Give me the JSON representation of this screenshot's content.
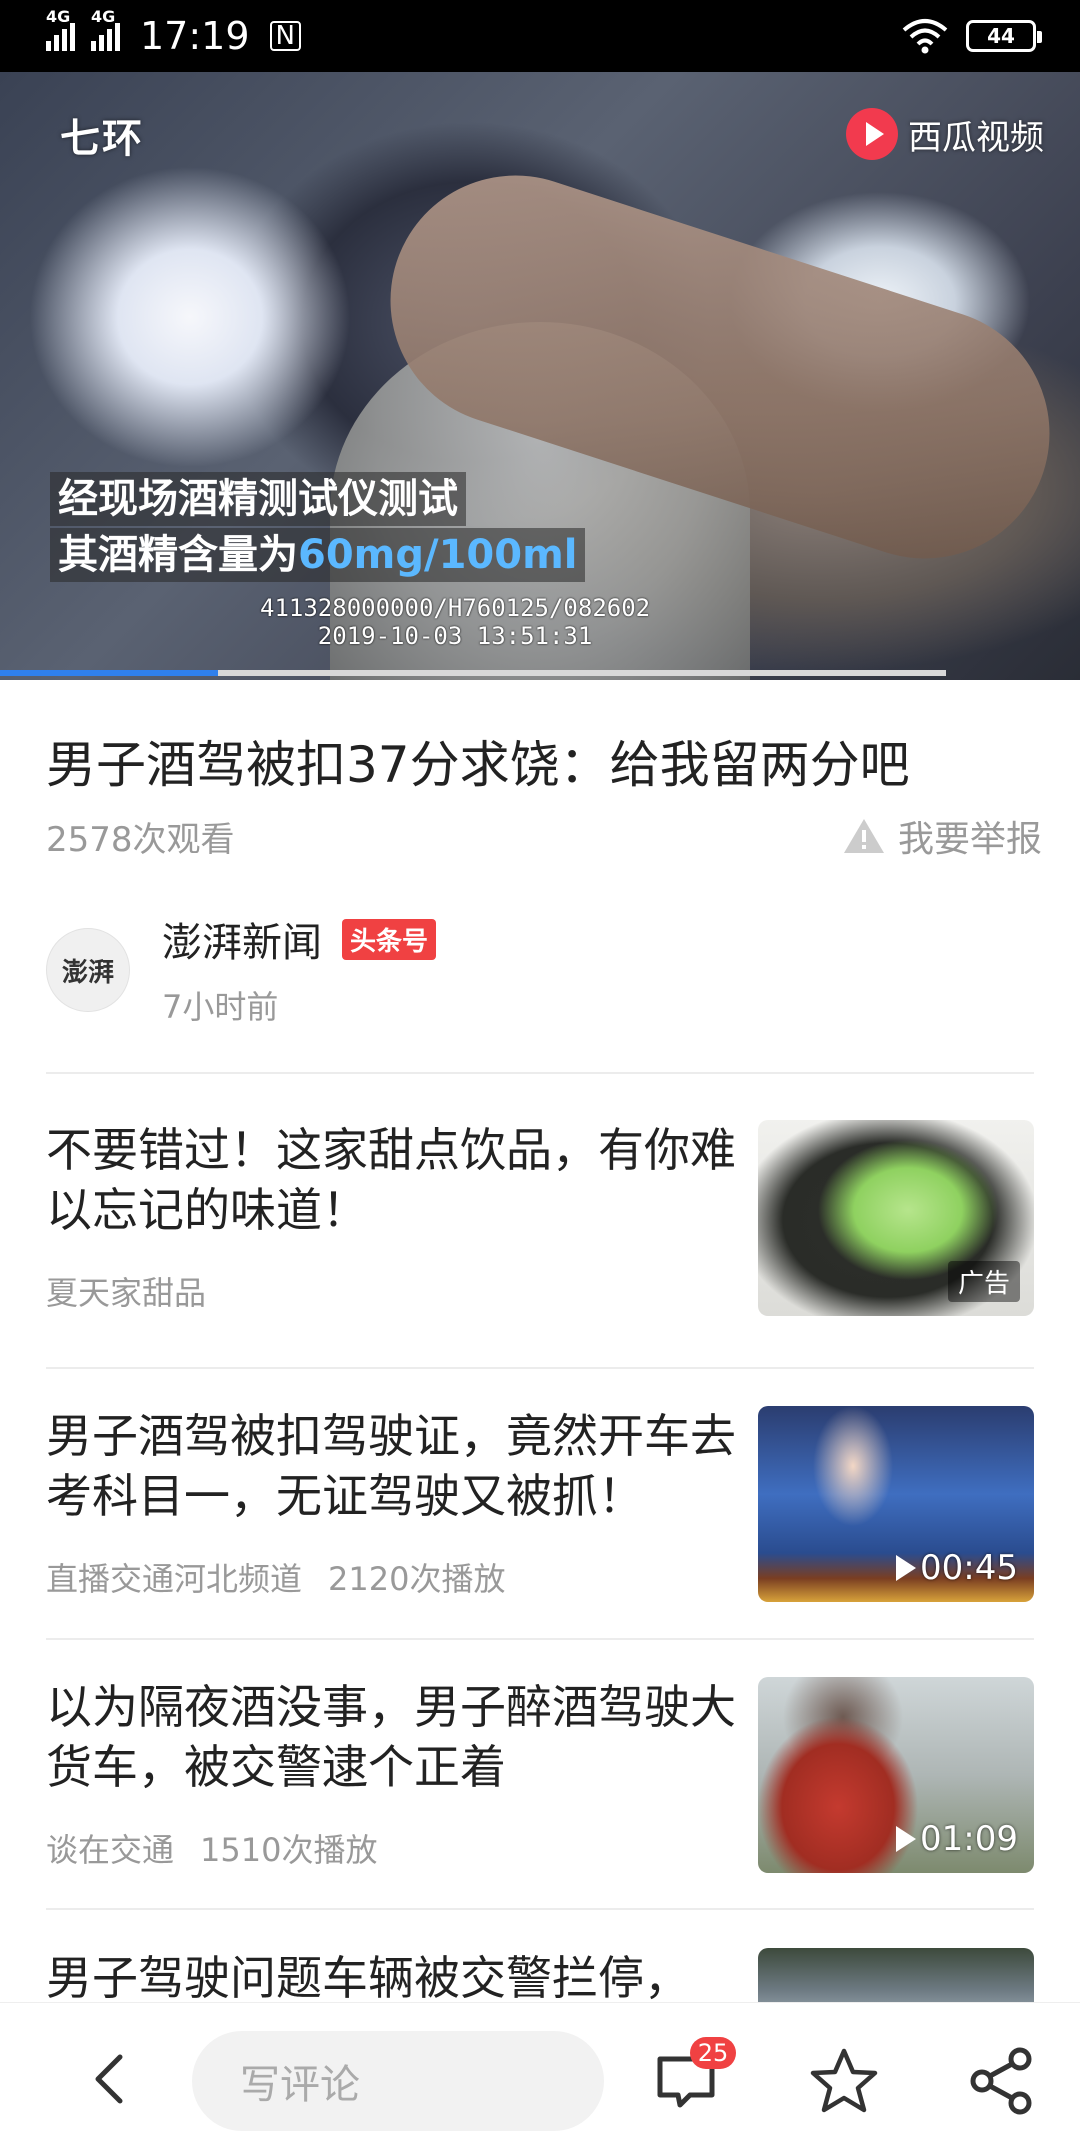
{
  "status_bar": {
    "network_1": "4G",
    "network_2": "4G",
    "time": "17:19",
    "nfc": "N",
    "battery": "44"
  },
  "video": {
    "logo_left": "七环",
    "logo_right": "西瓜视频",
    "caption_line1": "经现场酒精测试仪测试",
    "caption_line2_prefix": "其酒精含量为",
    "caption_line2_value": "60mg/100ml",
    "stamp_line1": "411328000000/H760125/082602",
    "stamp_line2": "2019-10-03 13:51:31",
    "progress_fraction": 0.23,
    "accent_color": "#2f80ed"
  },
  "article": {
    "title": "男子酒驾被扣37分求饶：给我留两分吧",
    "views": "2578次观看",
    "report_label": "我要举报",
    "author": {
      "avatar_text": "澎湃",
      "name": "澎湃新闻",
      "badge": "头条号",
      "time": "7小时前"
    }
  },
  "related": [
    {
      "title": "不要错过！这家甜点饮品，有你难以忘记的味道！",
      "source": "夏天家甜品",
      "plays": "",
      "tag": "广告",
      "duration": ""
    },
    {
      "title": "男子酒驾被扣驾驶证，竟然开车去考科目一，无证驾驶又被抓！",
      "source": "直播交通河北频道",
      "plays": "2120次播放",
      "tag": "",
      "duration": "00:45"
    },
    {
      "title": "以为隔夜酒没事，男子醉酒驾驶大货车，被交警逮个正着",
      "source": "谈在交通",
      "plays": "1510次播放",
      "tag": "",
      "duration": "01:09"
    },
    {
      "title": "男子驾驶问题车辆被交警拦停，"
    }
  ],
  "bottom_bar": {
    "comment_placeholder": "写评论",
    "comment_count": "25",
    "icons": [
      "back-icon",
      "comment-icon",
      "star-icon",
      "share-icon"
    ]
  }
}
